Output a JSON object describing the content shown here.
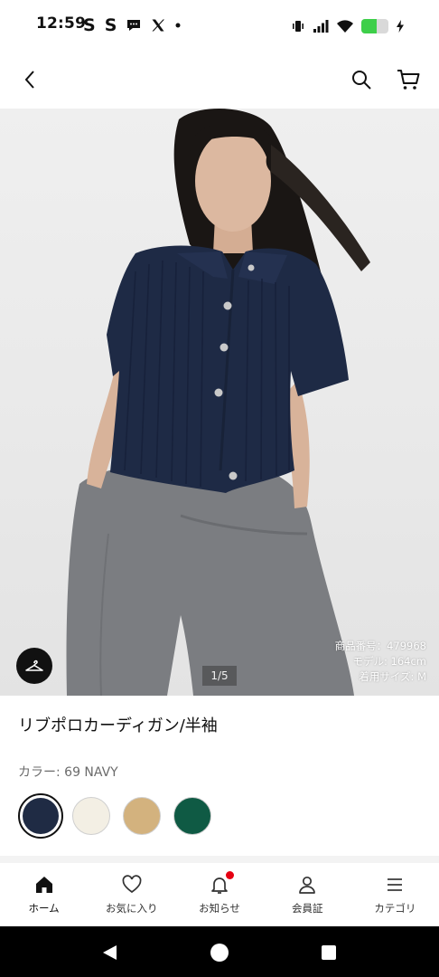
{
  "status_bar": {
    "time": "12:59",
    "left_icons": [
      "S",
      "S"
    ],
    "battery_level": 0.55,
    "battery_color": "#3ecf4a"
  },
  "product": {
    "title": "リブポロカーディガン/半袖",
    "color_label": "カラー: 69 NAVY",
    "image_counter": "1/5",
    "model_info": {
      "item_number": "商品番号：479968",
      "model": "モデル: 164cm",
      "size": "着用サイズ: M"
    },
    "swatches": [
      {
        "name": "NAVY",
        "color": "#1f2b44",
        "selected": true
      },
      {
        "name": "OFF WHITE",
        "color": "#f3efe4",
        "selected": false
      },
      {
        "name": "BEIGE",
        "color": "#d3b27e",
        "selected": false
      },
      {
        "name": "GREEN",
        "color": "#0f5a44",
        "selected": false
      }
    ]
  },
  "bottom_nav": {
    "items": [
      {
        "label": "ホーム",
        "icon": "home-icon",
        "active": true
      },
      {
        "label": "お気に入り",
        "icon": "heart-icon",
        "active": false
      },
      {
        "label": "お知らせ",
        "icon": "bell-icon",
        "active": false,
        "badge": true
      },
      {
        "label": "会員証",
        "icon": "user-icon",
        "active": false
      },
      {
        "label": "カテゴリ",
        "icon": "menu-icon",
        "active": false
      }
    ]
  },
  "colors": {
    "badge": "#e60012",
    "text_primary": "#111111",
    "text_secondary": "#6b6b6b"
  }
}
